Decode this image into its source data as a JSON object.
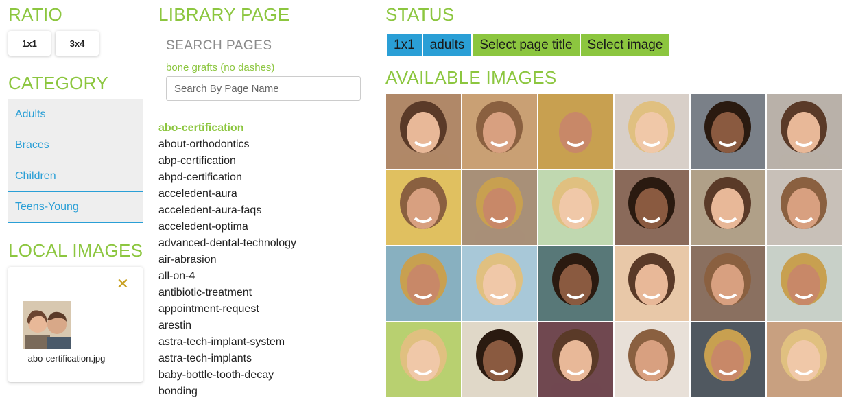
{
  "ratio": {
    "heading": "RATIO",
    "buttons": [
      "1x1",
      "3x4"
    ]
  },
  "category": {
    "heading": "CATEGORY",
    "items": [
      "Adults",
      "Braces",
      "Children",
      "Teens-Young"
    ]
  },
  "local_images": {
    "heading": "LOCAL IMAGES",
    "close_icon": "close-icon",
    "file_name": "abo-certification.jpg"
  },
  "library": {
    "heading": "LIBRARY PAGE",
    "search_label": "SEARCH PAGES",
    "search_hint": "bone grafts (no dashes)",
    "search_placeholder": "Search By Page Name",
    "pages": [
      "abo-certification",
      "about-orthodontics",
      "abp-certification",
      "abpd-certification",
      "acceledent-aura",
      "acceledent-aura-faqs",
      "acceledent-optima",
      "advanced-dental-technology",
      "air-abrasion",
      "all-on-4",
      "antibiotic-treatment",
      "appointment-request",
      "arestin",
      "astra-tech-implant-system",
      "astra-tech-implants",
      "baby-bottle-tooth-decay",
      "bonding"
    ],
    "selected_page": "abo-certification"
  },
  "status": {
    "heading": "STATUS",
    "tags": [
      {
        "label": "1x1",
        "color": "#2a9fd6"
      },
      {
        "label": "adults",
        "color": "#2a9fd6"
      },
      {
        "label": "Select page title",
        "color": "#8cc63f"
      },
      {
        "label": "Select image",
        "color": "#8cc63f"
      }
    ]
  },
  "available_images": {
    "heading": "AVAILABLE IMAGES",
    "tiles": [
      "#b08868",
      "#c9a074",
      "#c8a050",
      "#d8cfc8",
      "#7a8088",
      "#b9b1a9",
      "#e0c060",
      "#a89078",
      "#c0d8b0",
      "#8a6a5a",
      "#b0a088",
      "#c8c0b8",
      "#88b0c0",
      "#a8c8d8",
      "#587878",
      "#e8c8a8",
      "#8a7060",
      "#c8d0c8",
      "#b8d070",
      "#e0d8c8",
      "#704850",
      "#e8e0d8",
      "#505860",
      "#c8a080"
    ]
  },
  "colors": {
    "accent_green": "#8cc63f",
    "accent_blue": "#2a9fd6"
  }
}
